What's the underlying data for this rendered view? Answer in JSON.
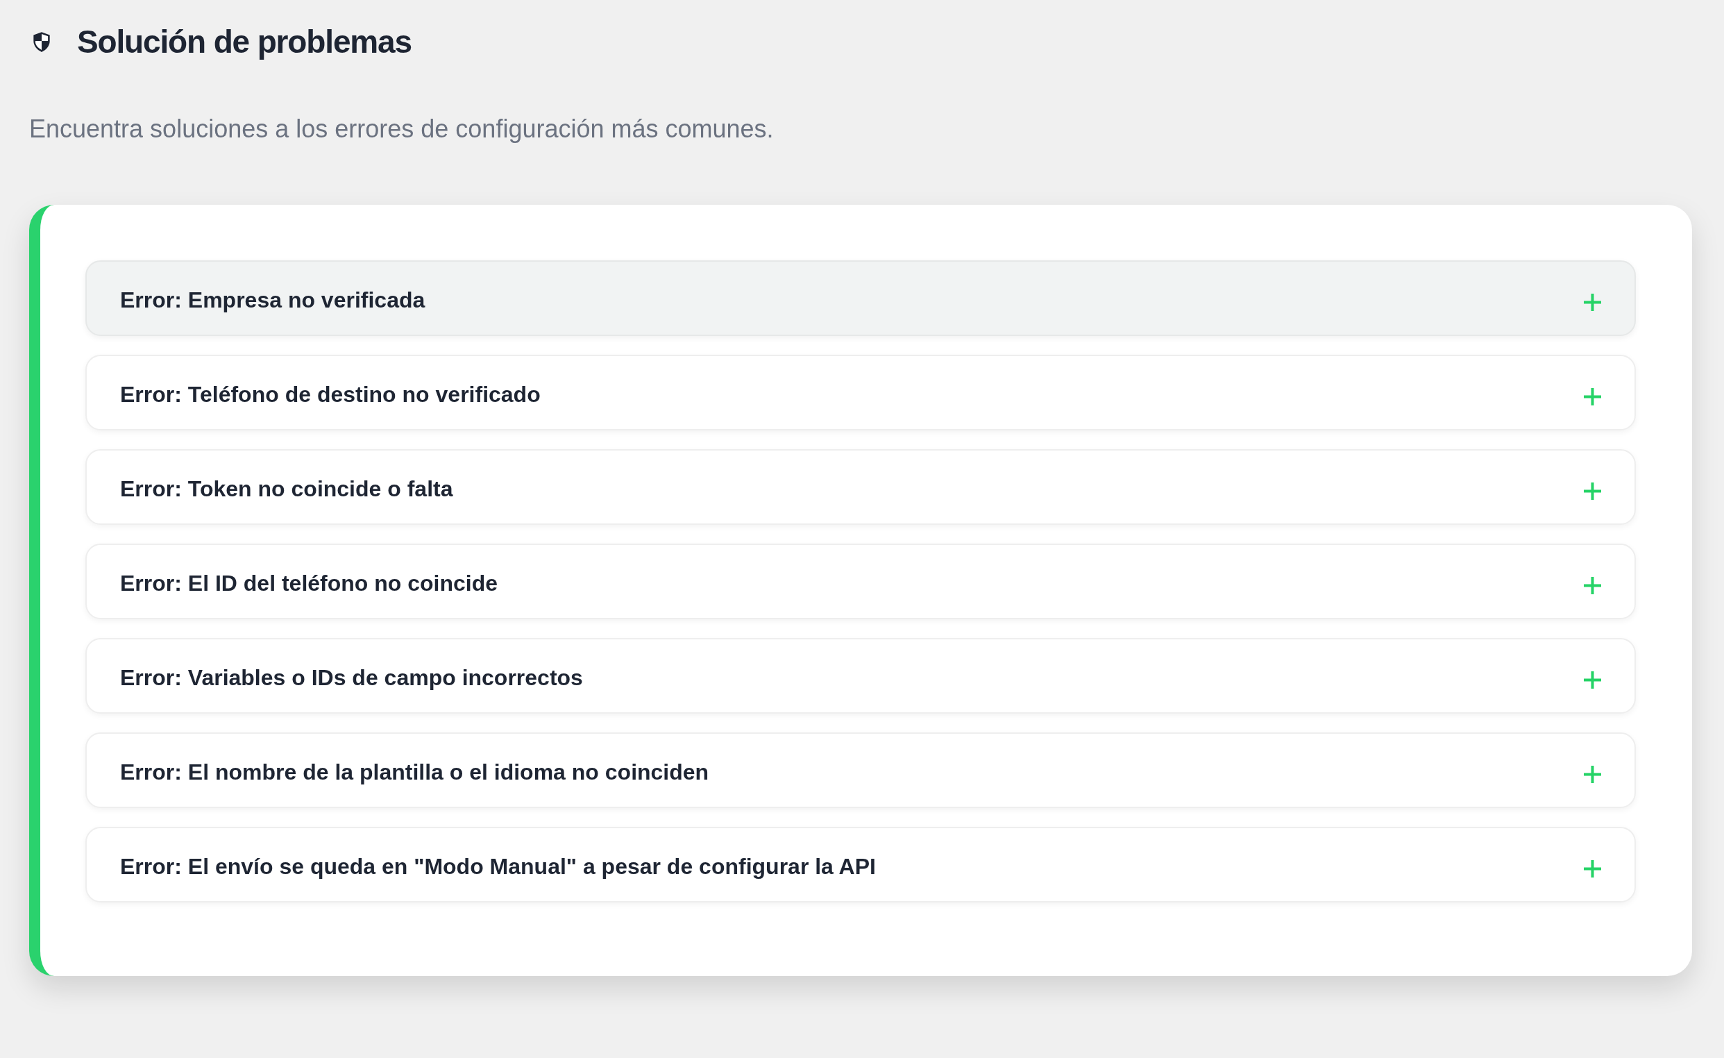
{
  "header": {
    "title": "Solución de problemas",
    "subtitle": "Encuentra soluciones a los errores de configuración más comunes."
  },
  "accordion": {
    "items": [
      {
        "title": "Error: Empresa no verificada",
        "expanded": false,
        "hovered": true
      },
      {
        "title": "Error: Teléfono de destino no verificado",
        "expanded": false,
        "hovered": false
      },
      {
        "title": "Error: Token no coincide o falta",
        "expanded": false,
        "hovered": false
      },
      {
        "title": "Error: El ID del teléfono no coincide",
        "expanded": false,
        "hovered": false
      },
      {
        "title": "Error: Variables o IDs de campo incorrectos",
        "expanded": false,
        "hovered": false
      },
      {
        "title": "Error: El nombre de la plantilla o el idioma no coinciden",
        "expanded": false,
        "hovered": false
      },
      {
        "title": "Error: El envío se queda en \"Modo Manual\" a pesar de configurar la API",
        "expanded": false,
        "hovered": false
      }
    ]
  }
}
